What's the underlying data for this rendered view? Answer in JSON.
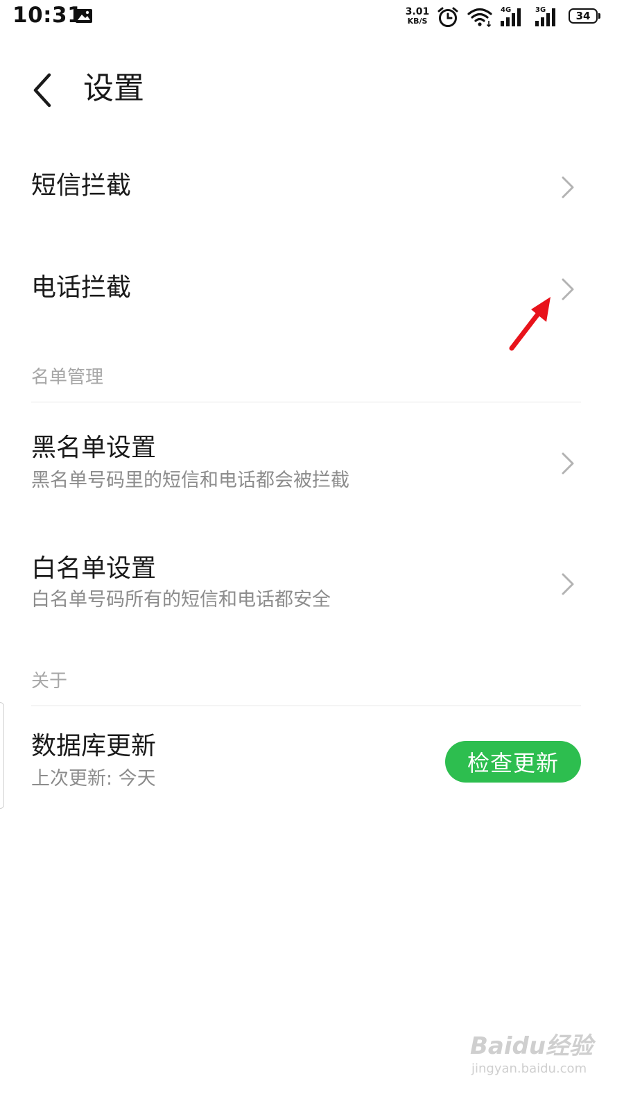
{
  "status_bar": {
    "time": "10:31",
    "net_speed_value": "3.01",
    "net_speed_unit": "KB/S",
    "network_1": "4G",
    "network_2": "3G",
    "battery": "34",
    "icons": [
      "image-notification-icon",
      "alarm-icon",
      "wifi-icon",
      "signal-icon",
      "signal-icon",
      "battery-icon"
    ]
  },
  "header": {
    "title": "设置",
    "back_icon": "chevron-left-icon"
  },
  "items": {
    "sms_block": {
      "title": "短信拦截"
    },
    "call_block": {
      "title": "电话拦截"
    }
  },
  "sections": {
    "list_management": {
      "label": "名单管理",
      "blacklist": {
        "title": "黑名单设置",
        "subtitle": "黑名单号码里的短信和电话都会被拦截"
      },
      "whitelist": {
        "title": "白名单设置",
        "subtitle": "白名单号码所有的短信和电话都安全"
      }
    },
    "about": {
      "label": "关于",
      "database_update": {
        "title": "数据库更新",
        "subtitle": "上次更新: 今天",
        "button_label": "检查更新"
      }
    }
  },
  "annotation": {
    "arrow_color": "#e8131b"
  },
  "colors": {
    "accent_green": "#2dbe4f",
    "subtitle_gray": "#8c8c8c",
    "chevron_gray": "#b3b3b3"
  },
  "watermark": {
    "brand": "Baidu经验",
    "url": "jingyan.baidu.com"
  }
}
